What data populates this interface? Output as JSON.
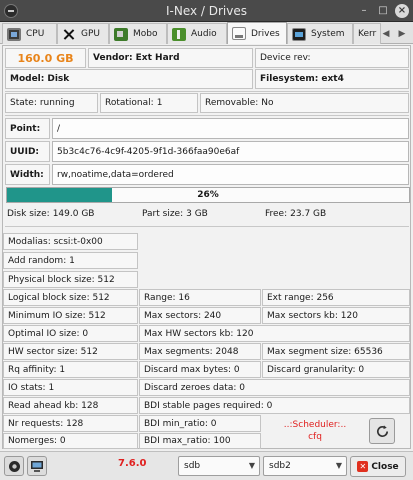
{
  "window": {
    "title": "I-Nex / Drives",
    "buttons": {
      "minimize": "–",
      "maximize": "□",
      "close": "×"
    }
  },
  "tabs": [
    {
      "label": "CPU",
      "icon": "cpu-icon"
    },
    {
      "label": "GPU",
      "icon": "gpu-icon"
    },
    {
      "label": "Mobo",
      "icon": "mobo-icon"
    },
    {
      "label": "Audio",
      "icon": "audio-icon"
    },
    {
      "label": "Drives",
      "icon": "drives-icon",
      "active": true
    },
    {
      "label": "System",
      "icon": "system-icon"
    },
    {
      "label": "Kerr",
      "icon": "kernel-icon"
    }
  ],
  "drive": {
    "size": "160.0 GB",
    "vendor_label": "Vendor:",
    "vendor": "Ext Hard",
    "device_rev_label": "Device rev:",
    "device_rev": "",
    "model_label": "Model:",
    "model": "Disk",
    "filesystem_label": "Filesystem:",
    "filesystem": "ext4",
    "state_label": "State:",
    "state": "running",
    "rotational_label": "Rotational:",
    "rotational": "1",
    "removable_label": "Removable:",
    "removable": "No",
    "point_label": "Point:",
    "point": "/",
    "uuid_label": "UUID:",
    "uuid": "5b3c4c76-4c9f-4205-9f1d-366faa90e6af",
    "width_label": "Width:",
    "width": "rw,noatime,data=ordered",
    "usage_percent": 26,
    "usage_text": "26%",
    "disk_size_label": "Disk size:",
    "disk_size": "149.0 GB",
    "part_size_label": "Part size:",
    "part_size": "3 GB",
    "free_label": "Free:",
    "free": "23.7 GB"
  },
  "details": {
    "modalias": "Modalias: scsi:t-0x00",
    "add_random": "Add random: 1",
    "physical_block_size": "Physical block size: 512",
    "logical_block_size": "Logical block size: 512",
    "range": "Range: 16",
    "ext_range": "Ext range: 256",
    "minimum_io_size": "Minimum IO size: 512",
    "max_sectors": "Max sectors: 240",
    "max_sectors_kb": "Max sectors kb: 120",
    "optimal_io_size": "Optimal IO size: 0",
    "max_hw_sectors_kb": "Max HW sectors kb: 120",
    "hw_sector_size": "HW sector size: 512",
    "max_segments": "Max segments: 2048",
    "max_segment_size": "Max segment size: 65536",
    "rq_affinity": "Rq affinity: 1",
    "discard_max_bytes": "Discard max bytes: 0",
    "discard_granularity": "Discard granularity: 0",
    "io_stats": "IO stats: 1",
    "discard_zeroes_data": "Discard zeroes data: 0",
    "read_ahead_kb": "Read ahead kb: 128",
    "bdi_stable_pages": "BDI stable pages required: 0",
    "nr_requests": "Nr requests: 128",
    "bdi_min_ratio": "BDI min_ratio: 0",
    "nomerges": "Nomerges: 0",
    "bdi_max_ratio": "BDI max_ratio: 100",
    "scheduler_line1": "..:Scheduler:..",
    "scheduler_line2": "cfq"
  },
  "bottom": {
    "version": "7.6.0",
    "disk_select": "sdb",
    "partition_select": "sdb2",
    "close_label": "Close"
  }
}
